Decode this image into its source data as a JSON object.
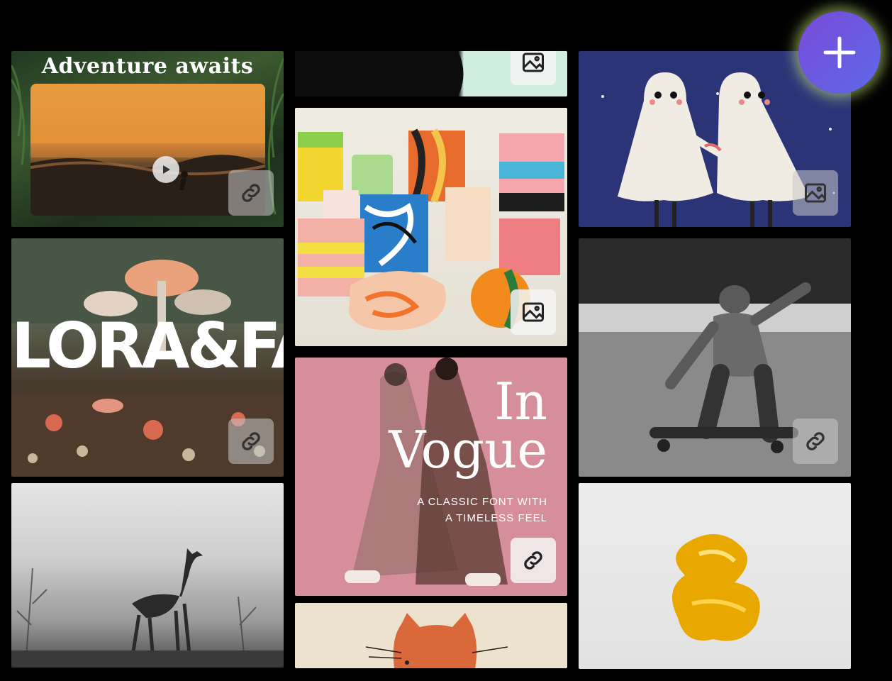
{
  "tiles": {
    "adventure": {
      "title": "Adventure awaits",
      "badge_icon": "link-icon"
    },
    "strip": {
      "badge_icon": "image-icon"
    },
    "ghosts": {
      "badge_icon": "image-icon"
    },
    "soaps": {
      "badge_icon": "image-icon"
    },
    "flora": {
      "headline": "LORA&FAUN",
      "badge_icon": "link-icon"
    },
    "skater": {
      "badge_icon": "link-icon"
    },
    "vogue": {
      "line1": "In",
      "line2": "Vogue",
      "sub1": "A CLASSIC FONT WITH",
      "sub2": "A TIMELESS FEEL",
      "badge_icon": "link-icon"
    },
    "deer": {},
    "cat": {},
    "gold": {}
  },
  "add_button": {
    "icon": "plus-icon"
  },
  "colors": {
    "add_button": "#6e58e0",
    "glow": "#d2f578",
    "vogue_bg": "#d68f9a",
    "ghost_bg": "#2c3478"
  }
}
